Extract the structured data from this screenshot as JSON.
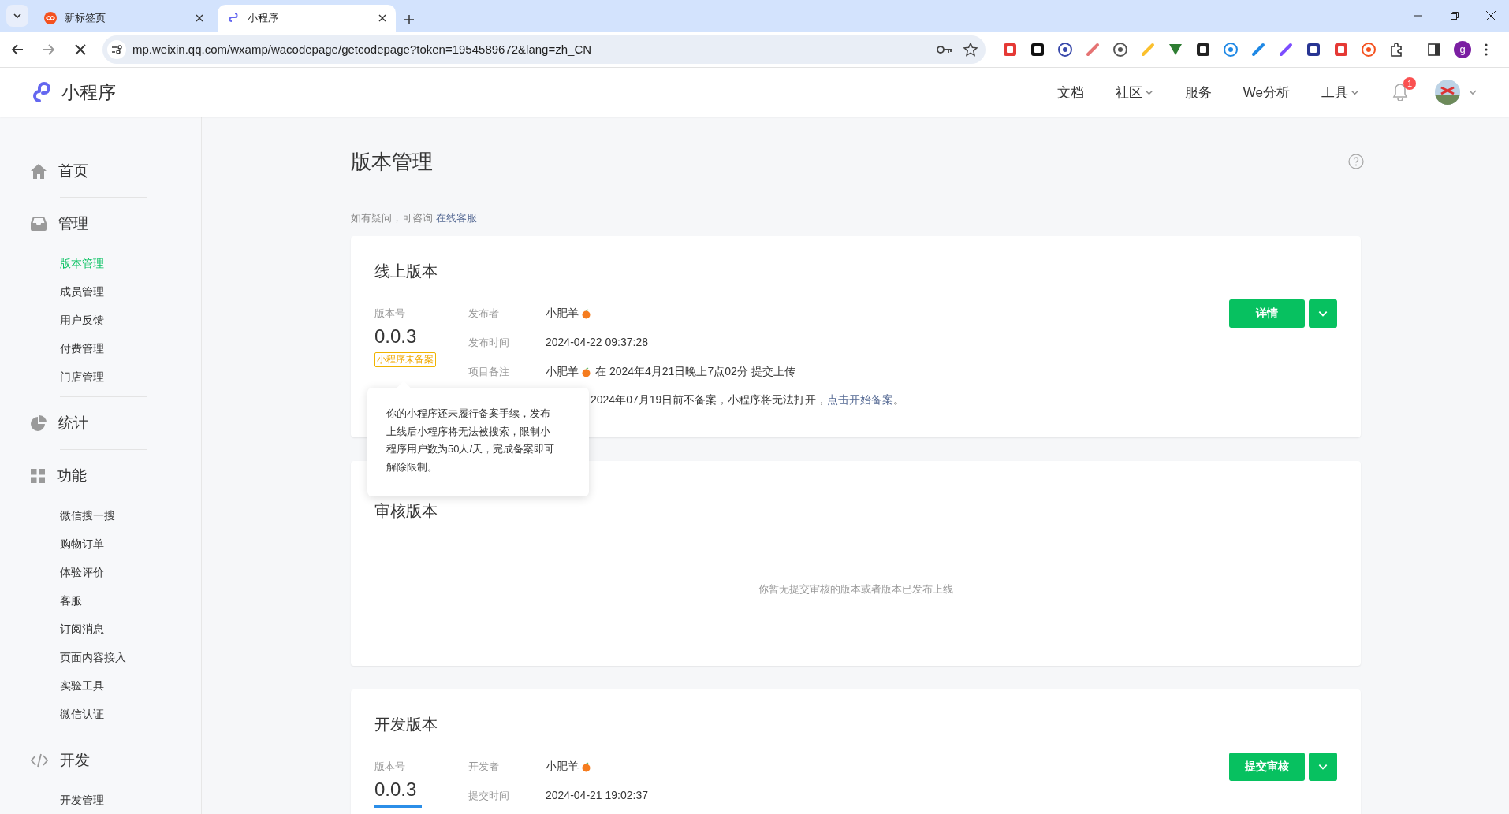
{
  "browser": {
    "tabs": [
      {
        "title": "新标签页",
        "selected": false
      },
      {
        "title": "小程序",
        "selected": true
      }
    ],
    "url": "mp.weixin.qq.com/wxamp/wacodepage/getcodepage?token=1954589672&lang=zh_CN",
    "profile_initial": "g"
  },
  "header": {
    "logo_text": "小程序",
    "nav": [
      {
        "label": "文档",
        "kind": "link"
      },
      {
        "label": "社区",
        "kind": "dropdown"
      },
      {
        "label": "服务",
        "kind": "link"
      },
      {
        "label": "We分析",
        "kind": "link"
      },
      {
        "label": "工具",
        "kind": "dropdown"
      }
    ],
    "notification_count": "1"
  },
  "sidebar": [
    {
      "label": "首页"
    },
    {
      "label": "管理",
      "children": [
        {
          "label": "版本管理",
          "selected": true
        },
        {
          "label": "成员管理",
          "selected": false
        },
        {
          "label": "用户反馈",
          "selected": false
        },
        {
          "label": "付费管理",
          "selected": false
        },
        {
          "label": "门店管理",
          "selected": false
        }
      ]
    },
    {
      "label": "统计"
    },
    {
      "label": "功能",
      "children": [
        {
          "label": "微信搜一搜",
          "selected": false
        },
        {
          "label": "购物订单",
          "selected": false
        },
        {
          "label": "体验评价",
          "selected": false
        },
        {
          "label": "客服",
          "selected": false
        },
        {
          "label": "订阅消息",
          "selected": false
        },
        {
          "label": "页面内容接入",
          "selected": false
        },
        {
          "label": "实验工具",
          "selected": false
        },
        {
          "label": "微信认证",
          "selected": false
        }
      ]
    },
    {
      "label": "开发",
      "children": [
        {
          "label": "开发管理",
          "selected": false
        }
      ]
    }
  ],
  "page": {
    "title": "版本管理",
    "help_text": "如有疑问，可咨询",
    "help_link": "在线客服"
  },
  "cards": [
    {
      "kind": "version",
      "title": "线上版本",
      "version_label": "版本号",
      "version": "0.0.3",
      "badge": "小程序未备案",
      "meta": [
        {
          "label": "发布者",
          "user": "小肥羊"
        },
        {
          "label": "发布时间",
          "value": "2024-04-22 09:37:28"
        },
        {
          "label": "项目备注",
          "user": "小肥羊",
          "value": "在 2024年4月21日晚上7点02分 提交上传"
        }
      ],
      "notice": {
        "text": "2024年07月19日前不备案，小程序将无法打开，",
        "link": "点击开始备案",
        "tail": "。"
      },
      "button": "详情"
    },
    {
      "kind": "empty",
      "title": "审核版本",
      "empty_text": "你暂无提交审核的版本或者版本已发布上线"
    },
    {
      "kind": "version",
      "title": "开发版本",
      "version_label": "版本号",
      "version": "0.0.3",
      "meta": [
        {
          "label": "开发者",
          "user": "小肥羊"
        },
        {
          "label": "提交时间",
          "value": "2024-04-21 19:02:37"
        }
      ],
      "button": "提交审核"
    }
  ],
  "tooltip": {
    "text": "你的小程序还未履行备案手续，发布上线后小程序将无法被搜索，限制小程序用户数为50人/天，完成备案即可解除限制。"
  }
}
